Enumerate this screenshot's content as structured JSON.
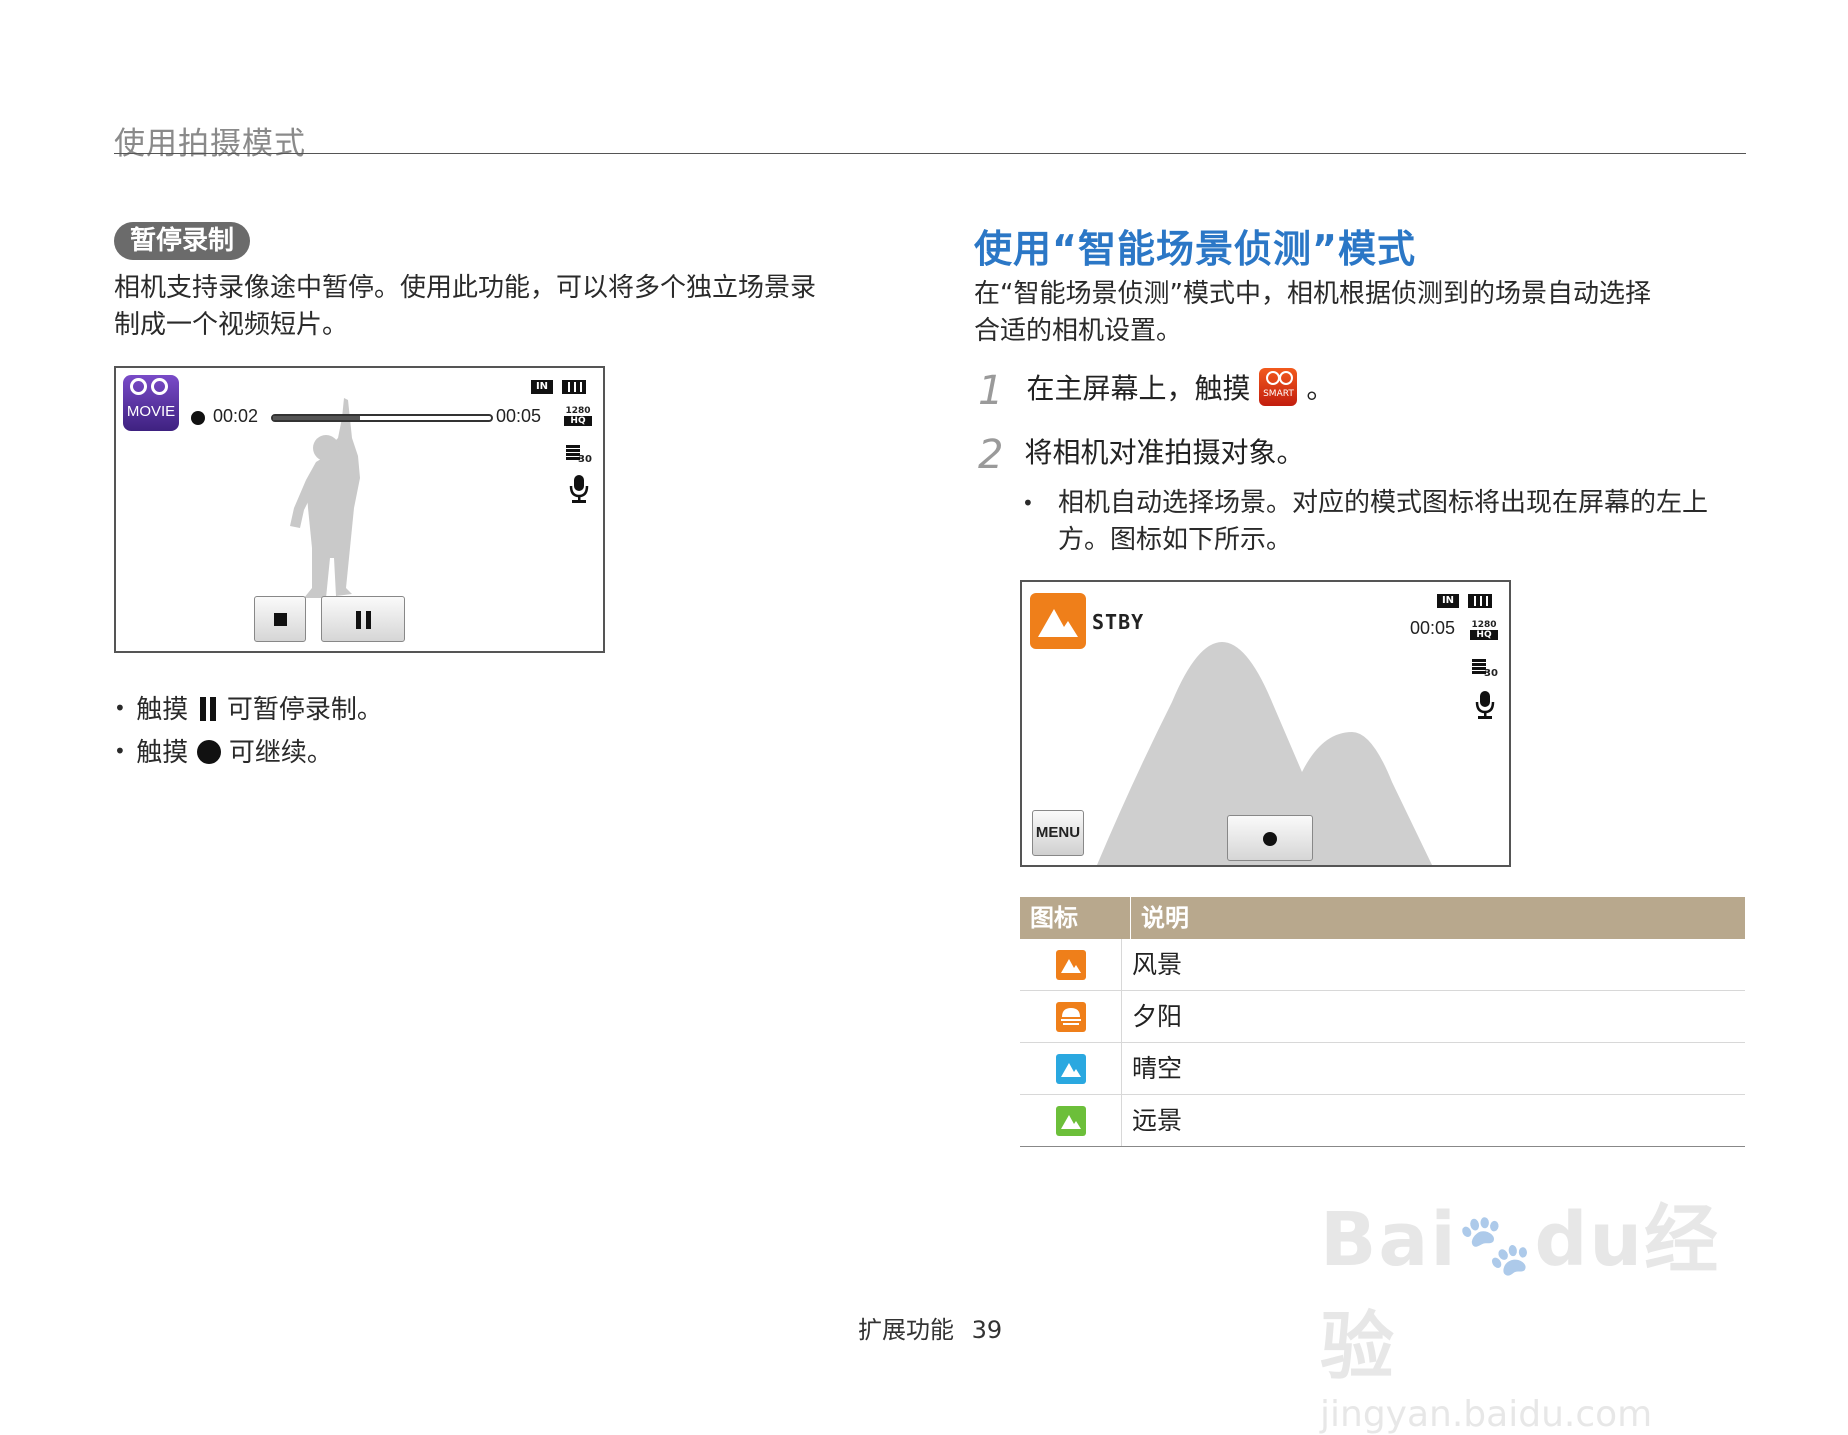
{
  "header": {
    "title": "使用拍摄模式"
  },
  "left": {
    "section_label": "暂停录制",
    "intro_line1": "相机支持录像途中暂停。使用此功能，可以将多个独立场景录",
    "intro_line2": "制成一个视频短片。",
    "screen": {
      "mode_label": "MOVIE",
      "time_elapsed": "00:02",
      "time_total": "00:05",
      "progress": 0.4,
      "resolution_top": "1280",
      "resolution_bottom": "HQ",
      "fps": "30",
      "storage": "IN"
    },
    "bullets": [
      {
        "prefix": "触摸",
        "suffix": "可暂停录制。"
      },
      {
        "prefix": "触摸",
        "suffix": "可继续。"
      }
    ]
  },
  "right": {
    "title": "使用“智能场景侦测”模式",
    "intro_line1": "在“智能场景侦测”模式中，相机根据侦测到的场景自动选择",
    "intro_line2": "合适的相机设置。",
    "steps": [
      {
        "num": "1",
        "text_before": "在主屏幕上，触摸",
        "text_after": "。"
      },
      {
        "num": "2",
        "text": "将相机对准拍摄对象。"
      }
    ],
    "sub_bullet_line1": "相机自动选择场景。对应的模式图标将出现在屏幕的左上",
    "sub_bullet_line2": "方。图标如下所示。",
    "smart_icon_label": "SMART",
    "screen": {
      "status": "STBY",
      "time": "00:05",
      "menu_label": "MENU",
      "resolution_top": "1280",
      "resolution_bottom": "HQ",
      "fps": "30",
      "storage": "IN"
    },
    "table": {
      "headers": [
        "图标",
        "说明"
      ],
      "rows": [
        {
          "icon": "landscape-icon",
          "color": "#ef7f1a",
          "label": "风景"
        },
        {
          "icon": "sunset-icon",
          "color": "#ef7f1a",
          "label": "夕阳"
        },
        {
          "icon": "clear-sky-icon",
          "color": "#2aa8e0",
          "label": "晴空"
        },
        {
          "icon": "distant-view-icon",
          "color": "#6cbf3a",
          "label": "远景"
        }
      ]
    }
  },
  "footer": {
    "text": "扩展功能",
    "page": "39"
  },
  "watermark": {
    "brand": "Bai",
    "brand2": "du",
    "cn": "经验",
    "url": "jingyan.baidu.com"
  },
  "colors": {
    "accent_blue": "#2b77c6",
    "table_header": "#b8a88d",
    "orange": "#ef7f1a"
  }
}
